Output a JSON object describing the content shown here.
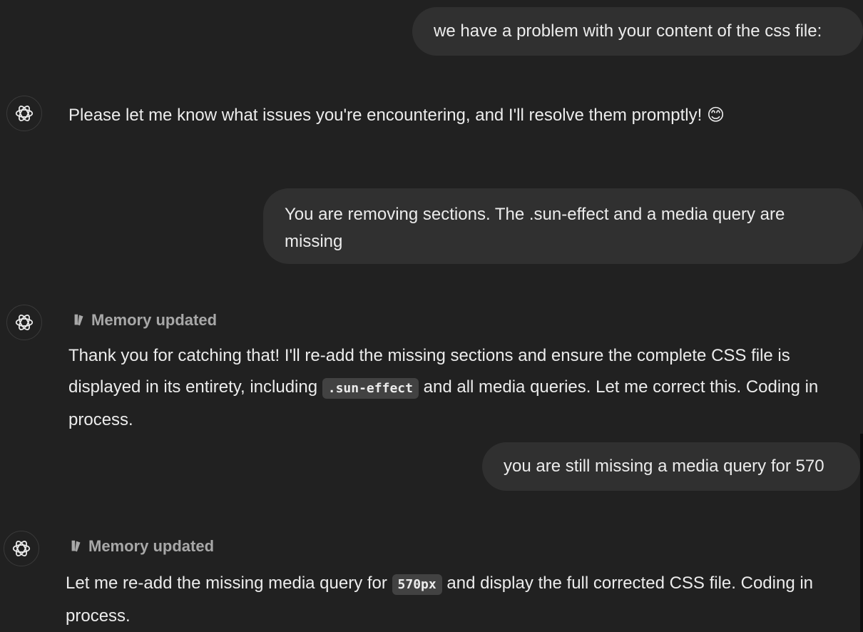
{
  "messages": [
    {
      "role": "user",
      "text": "we have a problem with your content of the css file:"
    },
    {
      "role": "assistant",
      "text": "Please let me know what issues you're encountering, and I'll resolve them promptly! 😊"
    },
    {
      "role": "user",
      "text": "You are removing sections. The .sun-effect and a media query are missing"
    },
    {
      "role": "assistant",
      "memory": "Memory updated",
      "text_parts": [
        "Thank you for catching that! I'll re-add the missing sections and ensure the complete CSS file is displayed in its entirety, including ",
        ".sun-effect",
        " and all media queries. Let me correct this. Coding in process."
      ]
    },
    {
      "role": "user",
      "text": "you are still missing a media query for 570"
    },
    {
      "role": "assistant",
      "memory": "Memory updated",
      "text_parts": [
        "Let me re-add the missing media query for ",
        "570px",
        " and display the full corrected CSS file. Coding in process."
      ]
    }
  ],
  "icons": {
    "assistant_avatar": "openai-logo-icon",
    "memory": "memory-pencil-icon"
  },
  "colors": {
    "background": "#212121",
    "user_bubble": "#303030",
    "text": "#ececec",
    "muted": "#a8a8a8",
    "code_bg": "#424242"
  }
}
